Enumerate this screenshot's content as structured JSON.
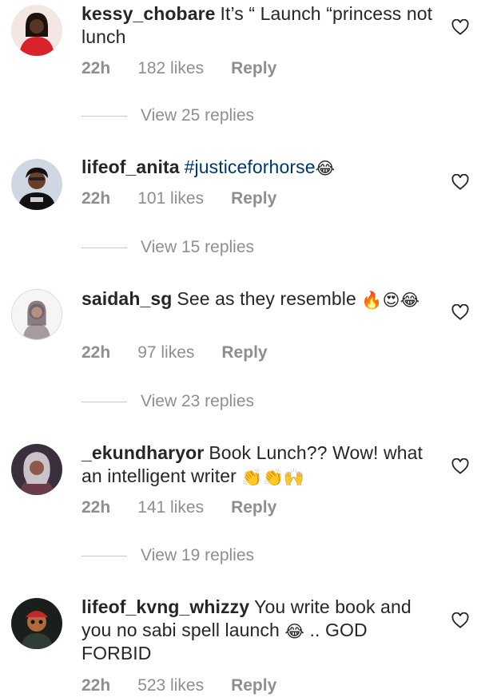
{
  "comments": [
    {
      "username": "kessy_chobare",
      "parts": [
        {
          "t": "It’s “ Launch “princess not lunch"
        }
      ],
      "time": "22h",
      "likes": "182 likes",
      "reply": "Reply",
      "view_replies": "View 25 replies"
    },
    {
      "username": "lifeof_anita",
      "parts": [
        {
          "t": "#justiceforhorse",
          "hashtag": true
        },
        {
          "emoji": "😂"
        }
      ],
      "time": "22h",
      "likes": "101 likes",
      "reply": "Reply",
      "view_replies": "View 15 replies"
    },
    {
      "username": "saidah_sg",
      "parts": [
        {
          "t": "See as they resemble "
        },
        {
          "emoji": "🔥"
        },
        {
          "emoji": "😍"
        },
        {
          "emoji": "😂"
        }
      ],
      "time": "22h",
      "likes": "97 likes",
      "reply": "Reply",
      "view_replies": "View 23 replies"
    },
    {
      "username": "_ekundharyor",
      "parts": [
        {
          "t": "Book Lunch?? Wow! what an intelligent writer "
        },
        {
          "emoji": "👏"
        },
        {
          "emoji": "👏"
        },
        {
          "emoji": "🙌"
        }
      ],
      "time": "22h",
      "likes": "141 likes",
      "reply": "Reply",
      "view_replies": "View 19 replies"
    },
    {
      "username": "lifeof_kvng_whizzy",
      "parts": [
        {
          "t": "You write book and you no sabi spell launch "
        },
        {
          "emoji": "😂"
        },
        {
          "t": " .. GOD FORBID"
        }
      ],
      "time": "22h",
      "likes": "523 likes",
      "reply": "Reply"
    }
  ],
  "icons": {
    "like": "heart-outline-icon"
  },
  "colors": {
    "meta": "#8e8e8e",
    "hashtag": "#00376b",
    "text": "#262626"
  }
}
